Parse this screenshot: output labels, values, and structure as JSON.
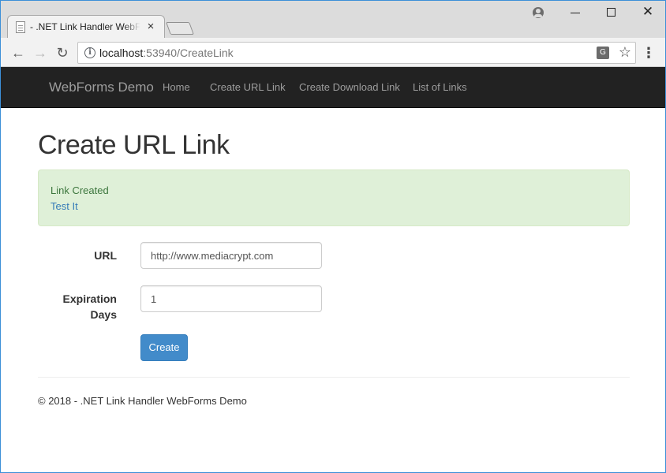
{
  "browser": {
    "tab": {
      "title": "- .NET Link Handler WebForms Demo",
      "close": "×"
    },
    "window_controls": {
      "minimize": "",
      "maximize": "",
      "close": "✕"
    },
    "toolbar": {
      "back": "←",
      "forward": "→",
      "reload": "↻",
      "url_host": "localhost",
      "url_rest": ":53940/CreateLink",
      "info_glyph": "i",
      "translate_glyph": "G",
      "star_glyph": "☆",
      "menu_glyph": "⋮"
    }
  },
  "navbar": {
    "brand": "WebForms Demo",
    "links": [
      {
        "label": "Home"
      },
      {
        "label": "Create URL Link"
      },
      {
        "label": "Create Download Link"
      },
      {
        "label": "List of Links"
      }
    ]
  },
  "page": {
    "title": "Create URL Link",
    "alert": {
      "message": "Link Created",
      "link": "Test It"
    },
    "form": {
      "url_label": "URL",
      "url_value": "http://www.mediacrypt.com",
      "expiration_label_line1": "Expiration",
      "expiration_label_line2": "Days",
      "expiration_value": "1",
      "submit_label": "Create"
    },
    "footer": "© 2018 - .NET Link Handler WebForms Demo"
  },
  "colors": {
    "navbar_bg": "#222222",
    "nav_text": "#9d9d9d",
    "alert_bg": "#dff0d8",
    "alert_text": "#3c763d",
    "link": "#337ab7",
    "primary_button": "#428bca"
  }
}
